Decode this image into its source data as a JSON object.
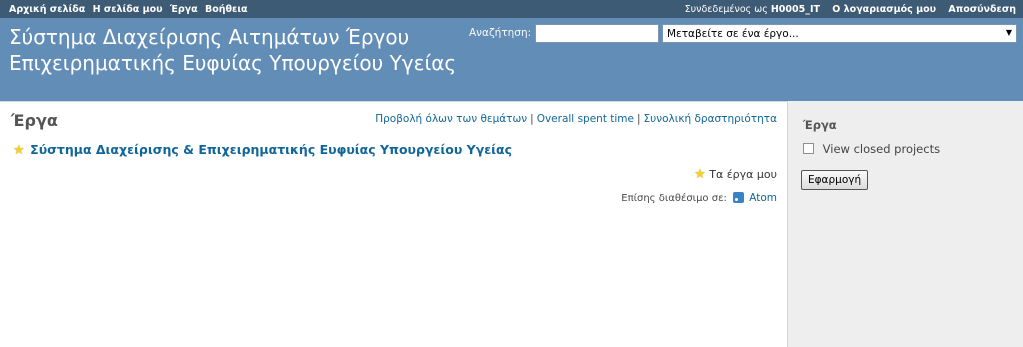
{
  "top_menu": {
    "home": "Αρχική σελίδα",
    "my_page": "Η σελίδα μου",
    "projects": "Έργα",
    "help": "Βοήθεια",
    "logged_as_label": "Συνδεδεμένος ως",
    "username": "H0005_IT",
    "my_account": "Ο λογαριασμός μου",
    "logout": "Αποσύνδεση"
  },
  "header": {
    "title": "Σύστημα Διαχείρισης Αιτημάτων Έργου Επιχειρηματικής Ευφυίας Υπουργείου Υγείας",
    "search_label": "Αναζήτηση:",
    "search_value": "",
    "jump_select": "Μεταβείτε σε ένα έργο..."
  },
  "content": {
    "page_title": "Έργα",
    "links": {
      "view_all_issues": "Προβολή όλων των θεμάτων",
      "overall_spent_time": "Overall spent time",
      "overall_activity": "Συνολική δραστηριότητα"
    },
    "project_name": "Σύστημα Διαχείρισης & Επιχειρηματικής Ευφυίας Υπουργείου Υγείας",
    "my_projects": "Τα έργα μου",
    "also_available": "Επίσης διαθέσιμο σε:",
    "atom": "Atom"
  },
  "sidebar": {
    "title": "Έργα",
    "closed_label": "View closed projects",
    "closed_checked": false,
    "apply": "Εφαρμογή"
  },
  "colors": {
    "top_menu_bg": "#3E5B76",
    "header_bg": "#628DB6",
    "sidebar_bg": "#EEEEEE",
    "link": "#169"
  }
}
